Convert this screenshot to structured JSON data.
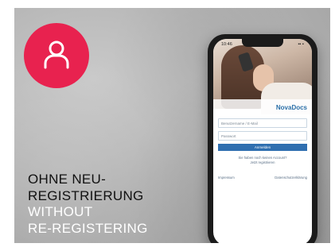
{
  "colors": {
    "accent": "#e8224f",
    "icon_stroke": "#ffffff",
    "button": "#2f6fb0",
    "logo": "#2a6fa8"
  },
  "badge": {
    "icon": "user-icon"
  },
  "caption": {
    "line1_de": "OHNE NEU-",
    "line2_de": "REGISTRIERUNG",
    "line3_en": "WITHOUT",
    "line4_en": "RE-REGISTERING"
  },
  "phone": {
    "status_time": "10:46",
    "status_icons": "▪▪ ▪",
    "logo": "NovaDocs",
    "fields": {
      "username_placeholder": "Benutzername / E-Mail",
      "password_placeholder": "Passwort"
    },
    "login_button": "Anmelden",
    "register_line1": "Sie haben noch keinen Account?",
    "register_line2": "Jetzt registrieren",
    "footer_left": "Impressum",
    "footer_right": "Datenschutzerklärung"
  }
}
